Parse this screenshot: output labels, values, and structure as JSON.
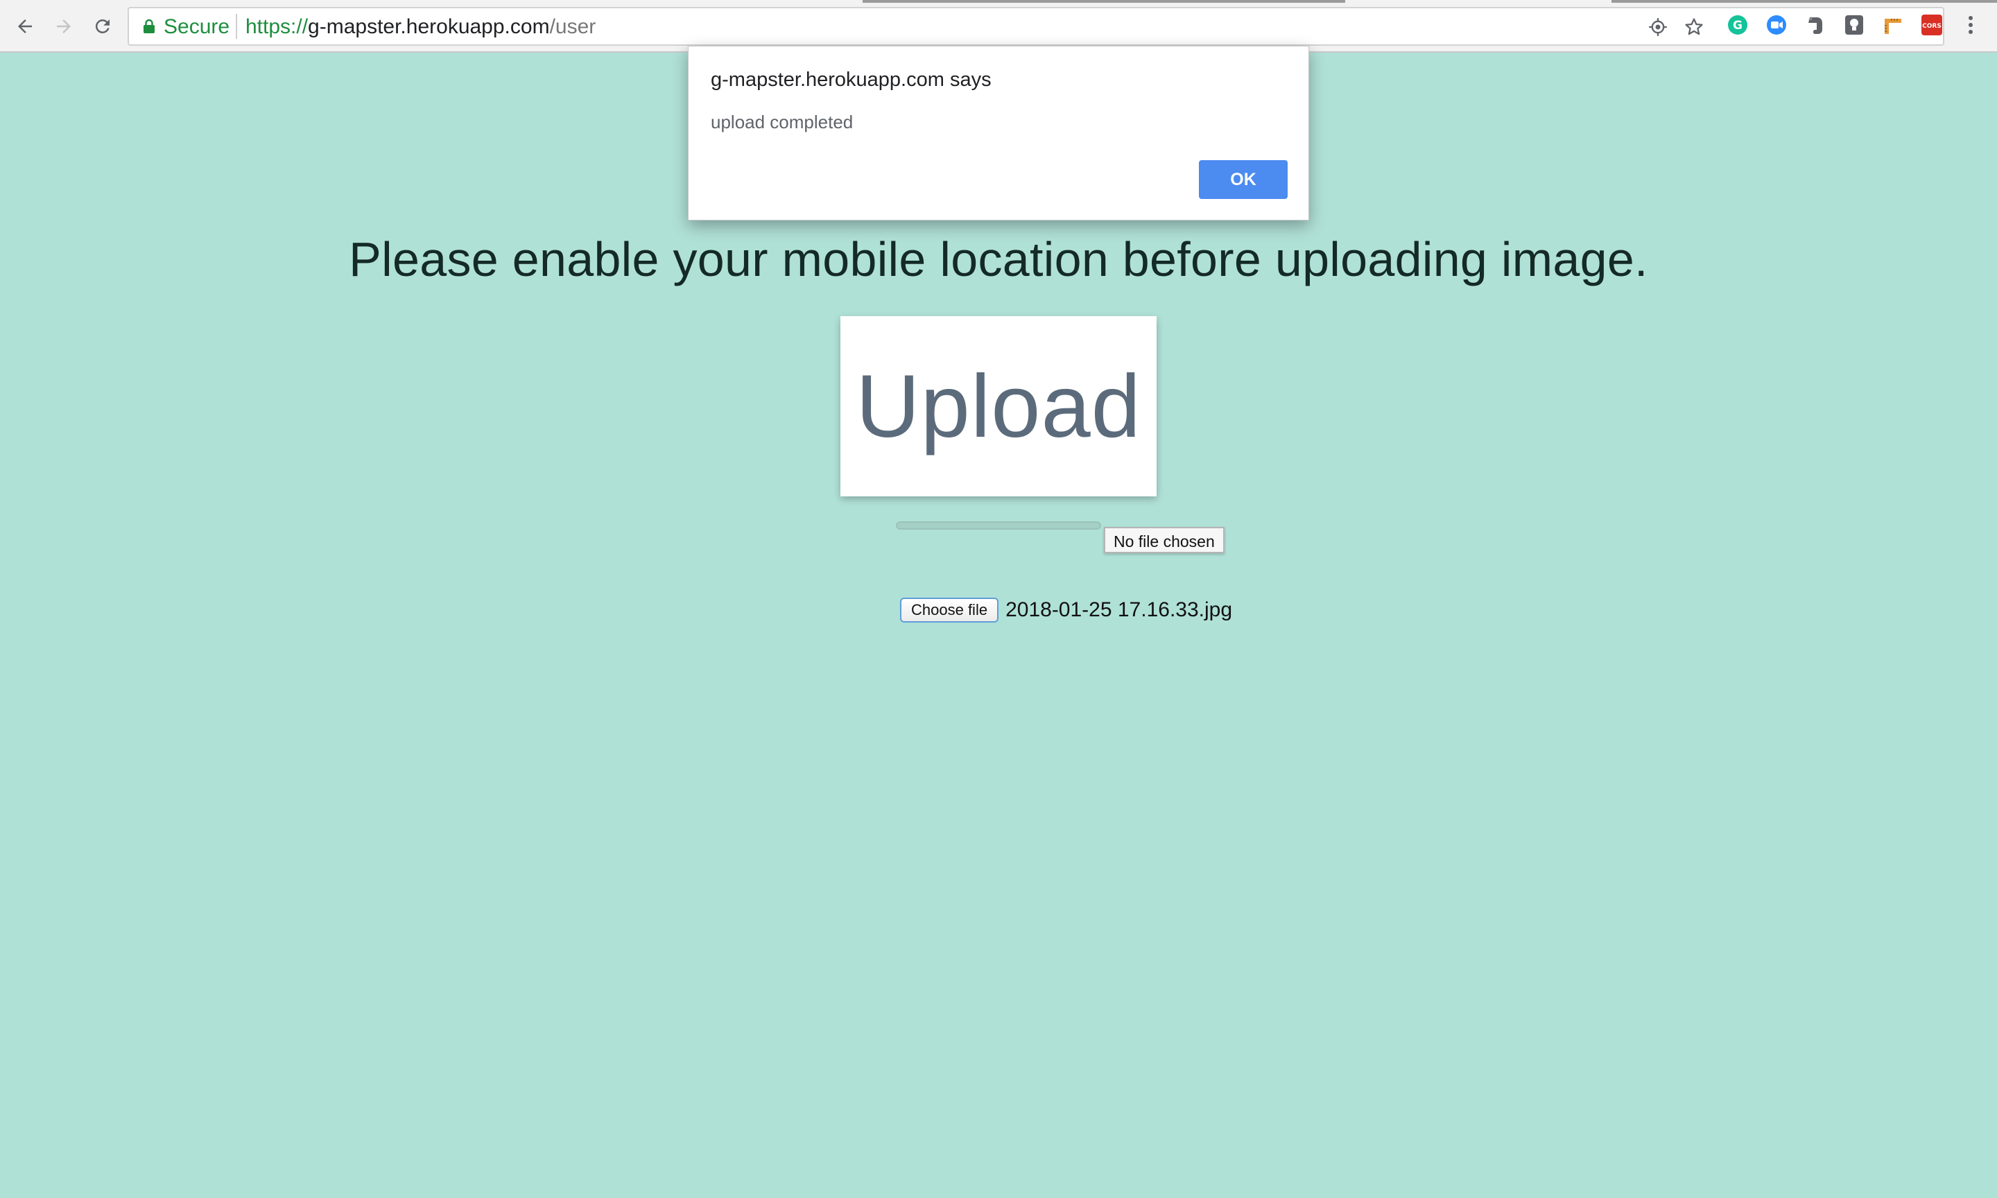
{
  "browser": {
    "security_label": "Secure",
    "url": {
      "scheme": "https://",
      "host": "g-mapster.herokuapp.com",
      "path": "/user"
    },
    "toolbar_icons": [
      "back-icon",
      "forward-icon",
      "reload-icon",
      "location-icon",
      "bookmark-star-icon"
    ],
    "extensions": [
      {
        "name": "grammarly-icon",
        "color": "#15c39a"
      },
      {
        "name": "zoom-icon",
        "color": "#2d8cff"
      },
      {
        "name": "evernote-icon",
        "color": "#5f6368"
      },
      {
        "name": "lightbulb-icon",
        "color": "#5f6368"
      },
      {
        "name": "ruler-icon",
        "color": "#e59b3a"
      },
      {
        "name": "cors-icon",
        "color": "#d93025",
        "label": "CORS"
      },
      {
        "name": "menu-kebab-icon",
        "color": "#5f6368"
      }
    ]
  },
  "page": {
    "background": "#b0e1d7",
    "headline": "Please enable your mobile location before uploading image.",
    "upload_button_label": "Upload",
    "progress_value": 0,
    "tooltip": "No file chosen",
    "file_input": {
      "button_label": "Choose file",
      "file_name": "2018-01-25 17.16.33.jpg"
    }
  },
  "dialog": {
    "title": "g-mapster.herokuapp.com says",
    "message": "upload completed",
    "ok_label": "OK",
    "ok_color": "#4c8bf0"
  }
}
